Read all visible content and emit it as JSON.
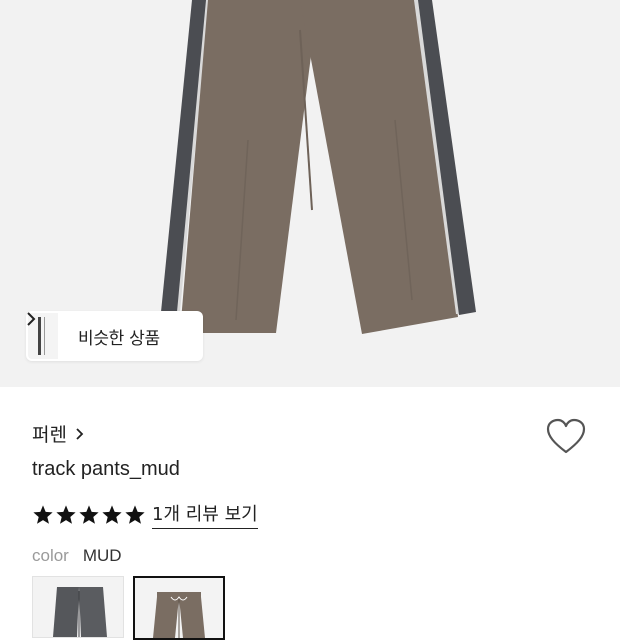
{
  "hero": {
    "image": "track-pants-mud-photo",
    "similar_products": {
      "label": "비슷한 상품",
      "icon": "chevron-right-icon"
    }
  },
  "product": {
    "brand": "퍼렌",
    "brand_icon": "chevron-right-icon",
    "title": "track pants_mud",
    "wishlist_icon": "heart-outline-icon",
    "rating": {
      "stars": 5,
      "max": 5,
      "review_link": "1개 리뷰 보기"
    },
    "color": {
      "key": "color",
      "value": "MUD",
      "options": [
        {
          "name": "gray",
          "selected": false
        },
        {
          "name": "mud",
          "selected": true
        }
      ]
    }
  },
  "colors": {
    "mud": "#7a6d62",
    "gray_panel": "#4a4c50",
    "background": "#f2f2f2",
    "accent": "#111111"
  }
}
